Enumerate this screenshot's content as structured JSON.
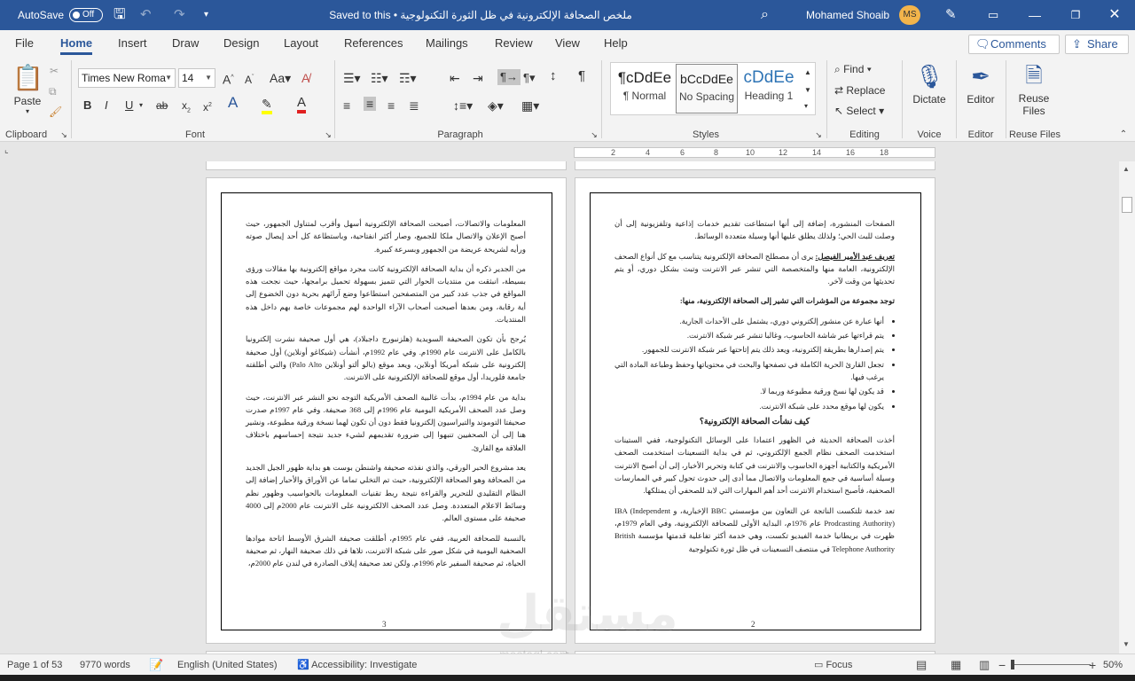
{
  "titlebar": {
    "autosave_label": "AutoSave",
    "autosave_state": "Off",
    "doc_title": "ملخص الصحافة الإلكترونية في ظل الثورة التكنولوجية • Saved to this PC",
    "user_name": "Mohamed Shoaib",
    "user_initials": "MS"
  },
  "tabs": [
    "File",
    "Home",
    "Insert",
    "Draw",
    "Design",
    "Layout",
    "References",
    "Mailings",
    "Review",
    "View",
    "Help"
  ],
  "actions": {
    "comments": "Comments",
    "share": "Share"
  },
  "ribbon": {
    "clipboard": {
      "paste": "Paste",
      "label": "Clipboard"
    },
    "font": {
      "name": "Times New Roma",
      "size": "14",
      "label": "Font"
    },
    "paragraph": {
      "label": "Paragraph"
    },
    "styles": {
      "label": "Styles",
      "items": [
        {
          "preview": "¶cDdEe",
          "name": "¶ Normal"
        },
        {
          "preview": "bCcDdEe",
          "name": "No Spacing"
        },
        {
          "preview": "cDdEe",
          "name": "Heading 1"
        }
      ]
    },
    "editing": {
      "find": "Find",
      "replace": "Replace",
      "select": "Select",
      "label": "Editing"
    },
    "voice": {
      "dictate": "Dictate",
      "label": "Voice"
    },
    "editor": {
      "editor": "Editor",
      "label": "Editor"
    },
    "reuse": {
      "reuse": "Reuse Files",
      "label": "Reuse Files"
    }
  },
  "ruler_numbers": [
    "2",
    "4",
    "6",
    "8",
    "10",
    "12",
    "14",
    "16",
    "18"
  ],
  "page_right": {
    "p1": "الصفحات المنشورة، إضافة إلى أنها استطاعت تقديم خدمات إذاعية وتلفزيونية إلى أن وصلت للبث الحي؛ ولذلك يطلق عليها أنها وسيلة متعددة الوسائط.",
    "p2_bold": "تعريف عبد الأمير الفيصل:",
    "p2": " يرى أن مصطلح الصحافة الإلكترونية يتناسب مع كل أنواع الصحف الإلكترونية، العامة منها والمتخصصة التي تنشر عبر الانترنت وتبث بشكل دوري، أو يتم تحديثها من وقت لآخر.",
    "heading1": "توجد مجموعة من المؤشرات التي تشير إلى الصحافة الإلكترونية، منها:",
    "bullets": [
      "أنها عبارة عن منشور إلكتروني دوري، يشتمل على الأحداث الجارية.",
      "يتم قراءتها عبر شاشة الحاسوب، وغالبا تنشر عبر شبكة الانترنت.",
      "يتم إصدارها بطريقة إلكترونية، ويعد ذلك يتم إتاحتها عبر شبكة الانترنت للجمهور.",
      "تجعل القارئ الحرية الكاملة في تصفحها والبحث في محتوياتها وحفظ وطباعة المادة التي يرغب فيها.",
      "قد يكون لها نسخ ورقية مطبوعة وربما لا.",
      "يكون لها موقع محدد على شبكة الانترنت."
    ],
    "heading2": "كيف نشأت الصحافة الإلكترونية؟",
    "p3": "أخذت الصحافة الحديثة في الظهور اعتمادا على الوسائل التكنولوجية، ففي الستينات استخدمت الصحف نظام الجمع الإلكتروني، ثم في بداية التسعينات استخدمت الصحف الأمريكية والكتابية أجهزة الحاسوب والانترنت في كتابة وتحرير الأخبار، إلى أن أصبح الانترنت وسيلة أساسية في جمع المعلومات والاتصال مما أدى إلى حدوث تحول كبير في الممارسات الصحفية، فأصبح استخدام الانترنت أحد أهم المهارات التي لابد للصحفي أن يمتلكها.",
    "p4": "تعد خدمة تلتكست الناتجة عن التعاون بين مؤسستي BBC الإخبارية، و IBA (Independent Prodcasting Authority) عام 1976م، البداية الأولى للصحافة الإلكترونية، وفي العام 1979م، ظهرت في بريطانيا خدمة الفيديو تكست، وهي خدمة أكثر تفاعلية قدمتها مؤسسة British Telephone Authority في منتصف التسعينات في ظل ثورة تكنولوجية",
    "page_number": "2"
  },
  "page_left": {
    "p1": "المعلومات والاتصالات، أصبحت الصحافة الإلكترونية أسهل وأقرب لمتناول الجمهور، حيث أصبح الإعلان والاتصال ملكا للجميع، وصار أكثر انفتاحية، وباستطاعة كل أحد إيصال صوته ورأيه لشريحة عريضة من الجمهور وبسرعة كبيرة.",
    "p2": "من الجدير ذكره أن بداية الصحافة الإلكترونية كانت مجرد مواقع إلكترونية بها مقالات ورؤى بسيطة، انبثقت من منتديات الحوار التي تتميز بسهولة تحميل برامجها، حيث نجحت هذه المواقع في جذب عدد كبير من المتصفحين استطاعوا وضع آرائهم بحرية دون الخضوع إلى أية رقابة، ومن بعدها أصبحت أصحاب الآراء الواحدة لهم مجموعات خاصة بهم داخل هذه المنتديات.",
    "p3": "يُرجح بأن تكون الصحيفة السويدية (هلزنبورج داجبلاد)، هي أول صحيفة نشرت إلكترونيا بالكامل على الانترنت عام 1990م. وفي عام 1992م، أنشأت (شيكاغو أونلاين) أول صحيفة إلكترونية على شبكة أمريكا أونلاين، ويعد موقع (بالو ألتو أونلاين Palo Alto) والتي أطلقته جامعة فلوريدا، أول موقع للصحافة الإلكترونية على الانترنت.",
    "p4": "بداية من عام 1994م، بدأت غالبية الصحف الأمريكية التوجه نحو النشر عبر الانترنت، حيث وصل عدد الصحف الأمريكية اليومية عام 1996م إلى 368 صحيفة. وفي عام 1997م صدرت صحيفتا التوموند والتيراسيون إلكترونيا فقط دون أن تكون لهما نسخة ورقية مطبوعة، ونشير هنا إلى أن الصحفيين تنبهوا إلى ضرورة تقديمهم لشيء جديد نتيجة إحساسهم باختلاف العلاقة مع القارئ.",
    "p5": "يعد مشروع الحبر الورقي، والذي نفذته صحيفة واشنطن بوست هو بداية ظهور الجيل الجديد من الصحافة وهو الصحافة الإلكترونية، حيث تم التخلي تماما عن الأوراق والأحبار إضافة إلى النظام التقليدي للتحرير والقراءة نتيجة ربط تقنيات المعلومات بالحواسيب وظهور نظم وسائط الاعلام المتعددة. وصل عدد الصحف الالكترونية على الانترنت عام 2000م إلى 4000 صحيفة على مستوى العالم.",
    "p6": "بالنسبة للصحافة العربية، ففي عام 1995م، أطلقت صحيفة الشرق الأوسط اتاحة موادها الصحفية اليومية في شكل صور على شبكة الانترنت، تلاها في ذلك صحيفة النهار، ثم صحيفة الحياة، ثم صحيفة السفير عام 1996م. ولكن تعد صحيفة إيلاف الصادرة في لندن عام 2000م،",
    "page_number": "3"
  },
  "status": {
    "page": "Page 1 of 53",
    "words": "9770 words",
    "language": "English (United States)",
    "accessibility": "Accessibility: Investigate",
    "focus": "Focus",
    "zoom": "50%"
  },
  "watermark": {
    "main": "مستقل",
    "sub": "mostaql.com"
  }
}
